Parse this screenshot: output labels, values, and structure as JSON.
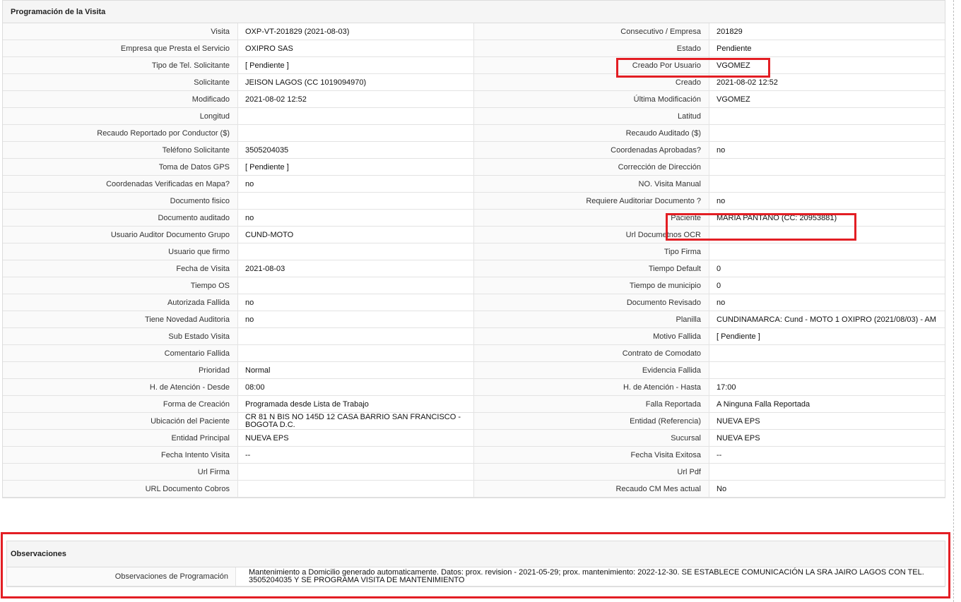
{
  "section_title": "Programación de la Visita",
  "rows": [
    {
      "l1": "Visita",
      "v1": "OXP-VT-201829 (2021-08-03)",
      "l2": "Consecutivo / Empresa",
      "v2": "201829"
    },
    {
      "l1": "Empresa que Presta el Servicio",
      "v1": "OXIPRO SAS",
      "l2": "Estado",
      "v2": "Pendiente"
    },
    {
      "l1": "Tipo de Tel. Solicitante",
      "v1": "[ Pendiente ]",
      "l2": "Creado Por Usuario",
      "v2": "VGOMEZ"
    },
    {
      "l1": "Solicitante",
      "v1": "JEISON LAGOS (CC 1019094970)",
      "l2": "Creado",
      "v2": "2021-08-02 12:52"
    },
    {
      "l1": "Modificado",
      "v1": "2021-08-02 12:52",
      "l2": "Última Modificación",
      "v2": " VGOMEZ"
    },
    {
      "l1": "Longitud",
      "v1": "",
      "l2": "Latitud",
      "v2": ""
    },
    {
      "l1": "Recaudo Reportado por Conductor ($)",
      "v1": "",
      "l2": "Recaudo Auditado ($)",
      "v2": ""
    },
    {
      "l1": "Teléfono Solicitante",
      "v1": "3505204035",
      "l2": "Coordenadas Aprobadas?",
      "v2": " no"
    },
    {
      "l1": "Toma de Datos GPS",
      "v1": "[ Pendiente ]",
      "l2": "Corrección de Dirección",
      "v2": ""
    },
    {
      "l1": "Coordenadas Verificadas en Mapa?",
      "v1": " no",
      "l2": "NO. Visita Manual",
      "v2": ""
    },
    {
      "l1": "Documento fisico",
      "v1": "",
      "l2": "Requiere Auditoriar Documento ?",
      "v2": " no"
    },
    {
      "l1": "Documento auditado",
      "v1": " no",
      "l2": "Paciente",
      "v2": "MARIA PANTANO (CC: 20953881)"
    },
    {
      "l1": "Usuario Auditor Documento Grupo",
      "v1": "CUND-MOTO",
      "l2": "Url Documetnos OCR",
      "v2": ""
    },
    {
      "l1": "Usuario que firmo",
      "v1": "",
      "l2": "Tipo Firma",
      "v2": ""
    },
    {
      "l1": "Fecha de Visita",
      "v1": " 2021-08-03",
      "l2": "Tiempo Default",
      "v2": " 0"
    },
    {
      "l1": "Tiempo OS",
      "v1": "",
      "l2": "Tiempo de municipio",
      "v2": " 0"
    },
    {
      "l1": "Autorizada Fallida",
      "v1": " no",
      "l2": "Documento Revisado",
      "v2": " no"
    },
    {
      "l1": "Tiene Novedad Auditoria",
      "v1": " no",
      "l2": "Planilla",
      "v2": "CUNDINAMARCA: Cund - MOTO 1 OXIPRO (2021/08/03) - AM"
    },
    {
      "l1": "Sub Estado Visita",
      "v1": "",
      "l2": "Motivo Fallida",
      "v2": "[ Pendiente ]"
    },
    {
      "l1": "Comentario Fallida",
      "v1": "",
      "l2": "Contrato de Comodato",
      "v2": ""
    },
    {
      "l1": "Prioridad",
      "v1": "Normal",
      "l2": "Evidencia Fallida",
      "v2": ""
    },
    {
      "l1": "H. de Atención - Desde",
      "v1": "08:00",
      "l2": "H. de Atención - Hasta",
      "v2": " 17:00"
    },
    {
      "l1": "Forma de Creación",
      "v1": "Programada desde Lista de Trabajo",
      "l2": "Falla Reportada",
      "v2": "A Ninguna Falla Reportada"
    },
    {
      "l1": "Ubicación del Paciente",
      "v1": "CR 81 N BIS NO 145D 12 CASA BARRIO SAN FRANCISCO - BOGOTA D.C.",
      "l2": "Entidad (Referencia)",
      "v2": "NUEVA EPS"
    },
    {
      "l1": "Entidad Principal",
      "v1": "NUEVA EPS",
      "l2": "Sucursal",
      "v2": "NUEVA EPS"
    },
    {
      "l1": "Fecha Intento Visita",
      "v1": " --",
      "l2": "Fecha Visita Exitosa",
      "v2": " --"
    },
    {
      "l1": "Url Firma",
      "v1": "",
      "l2": "Url Pdf",
      "v2": ""
    },
    {
      "l1": "URL Documento Cobros",
      "v1": "",
      "l2": "Recaudo CM Mes actual",
      "v2": " No"
    }
  ],
  "observations": {
    "title": "Observaciones",
    "label": "Observaciones de Programación",
    "value": "Mantenimiento a Domicilio generado automaticamente. Datos: prox. revision - 2021-05-29; prox. mantenimiento: 2022-12-30. SE ESTABLECE COMUNICACIÓN LA SRA JAIRO LAGOS CON TEL. 3505204035 Y SE PROGRAMA VISITA DE MANTENIMIENTO"
  },
  "colors": {
    "highlight": "#e31e24",
    "header_bg": "#f5f5f5",
    "border": "#dcdcdc"
  }
}
